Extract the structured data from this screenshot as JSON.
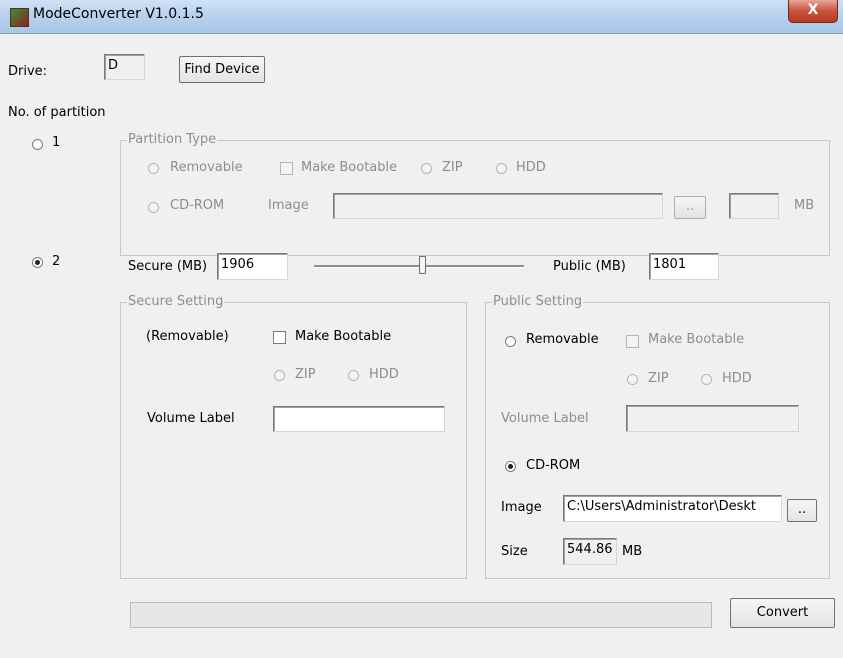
{
  "window": {
    "title": "ModeConverter V1.0.1.5",
    "close_label": "X"
  },
  "drive": {
    "label": "Drive:",
    "value": "D",
    "find_button": "Find Device"
  },
  "partitions": {
    "label": "No. of partition",
    "option1": {
      "label": "1",
      "selected": false
    },
    "option2": {
      "label": "2",
      "selected": true
    }
  },
  "partition_type": {
    "group_title": "Partition Type",
    "removable": "Removable",
    "make_bootable": "Make Bootable",
    "zip": "ZIP",
    "hdd": "HDD",
    "cdrom": "CD-ROM",
    "image_label": "Image",
    "image_value": "",
    "browse": "..",
    "size_value": "",
    "unit": "MB"
  },
  "sizes": {
    "secure_label": "Secure (MB)",
    "secure_value": "1906",
    "public_label": "Public (MB)",
    "public_value": "1801",
    "slider_fraction": 0.514
  },
  "secure_setting": {
    "group_title": "Secure Setting",
    "mode": "(Removable)",
    "make_bootable": "Make Bootable",
    "zip": "ZIP",
    "hdd": "HDD",
    "volume_label": "Volume Label",
    "volume_value": ""
  },
  "public_setting": {
    "group_title": "Public Setting",
    "removable": "Removable",
    "make_bootable": "Make Bootable",
    "zip": "ZIP",
    "hdd": "HDD",
    "volume_label": "Volume Label",
    "volume_value": "",
    "cdrom": "CD-ROM",
    "image_label": "Image",
    "image_value": "C:\\Users\\Administrator\\Deskt",
    "browse": "..",
    "size_label": "Size",
    "size_value": "544.86",
    "size_unit": "MB"
  },
  "footer": {
    "convert": "Convert",
    "progress": 0
  }
}
